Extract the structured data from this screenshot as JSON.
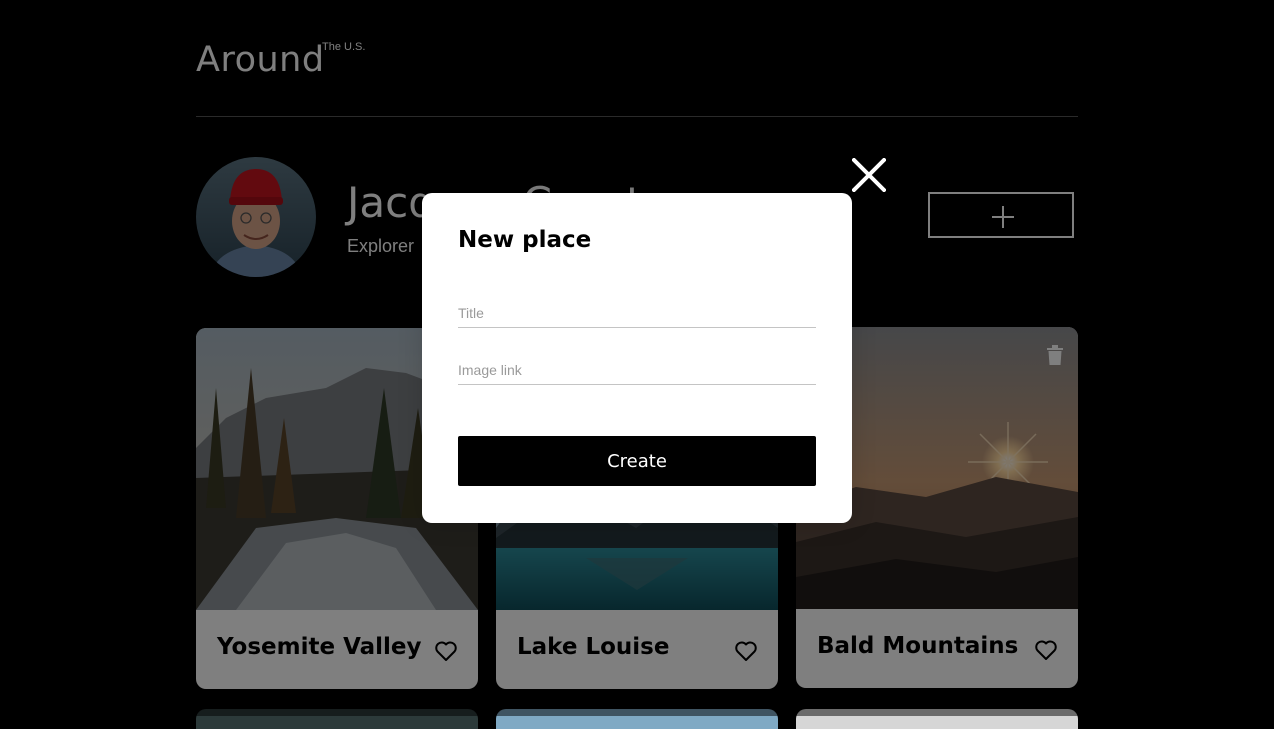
{
  "header": {
    "logo_main": "Around",
    "logo_sup": "The U.S."
  },
  "profile": {
    "name": "Jacques Cousteau",
    "job": "Explorer",
    "add_button_icon": "plus-icon"
  },
  "cards": [
    {
      "title": "Yosemite Valley",
      "like_icon": "heart-icon"
    },
    {
      "title": "Lake Louise",
      "like_icon": "heart-icon"
    },
    {
      "title": "Bald Mountains",
      "like_icon": "heart-icon",
      "delete_icon": "trash-icon"
    }
  ],
  "modal": {
    "title": "New place",
    "title_placeholder": "Title",
    "title_value": "",
    "link_placeholder": "Image link",
    "link_value": "",
    "submit_label": "Create",
    "close_icon": "close-icon"
  },
  "colors": {
    "background": "#000000",
    "card": "#ffffff",
    "overlay": "rgba(0,0,0,0.5)"
  }
}
